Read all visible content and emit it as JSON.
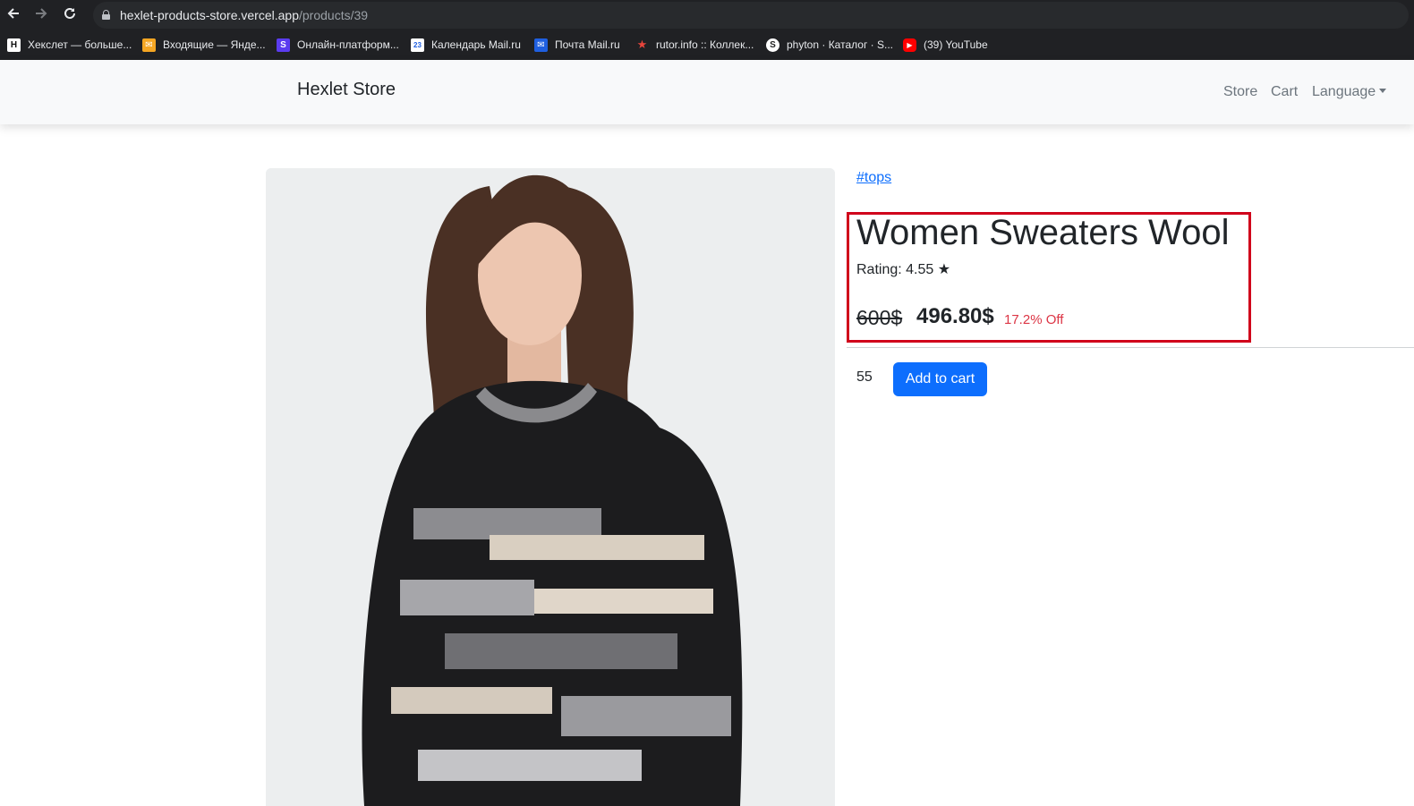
{
  "browser": {
    "url_host": "hexlet-products-store.vercel.app",
    "url_path": "/products/39",
    "bookmarks": [
      {
        "label": "Хекслет — больше...",
        "icon": "hexlet-icon",
        "color": "#111111",
        "glyph": "H"
      },
      {
        "label": "Входящие — Янде...",
        "icon": "yandex-mail-icon",
        "color": "#f5a623",
        "glyph": "✉"
      },
      {
        "label": "Онлайн-платформ...",
        "icon": "skillbox-icon",
        "color": "#5b3cf0",
        "glyph": "S"
      },
      {
        "label": "Календарь Mail.ru",
        "icon": "calendar-icon",
        "color": "#ffffff",
        "glyph": "23"
      },
      {
        "label": "Почта Mail.ru",
        "icon": "mail-ru-icon",
        "color": "#1f5fe0",
        "glyph": "✉"
      },
      {
        "label": "rutor.info :: Коллек...",
        "icon": "rutor-icon",
        "color": "#e8453c",
        "glyph": "★"
      },
      {
        "label": "phyton · Каталог · S...",
        "icon": "stepik-icon",
        "color": "#222222",
        "glyph": "S"
      },
      {
        "label": "(39) YouTube",
        "icon": "youtube-icon",
        "color": "#ff0000",
        "glyph": "▶"
      }
    ]
  },
  "navbar": {
    "brand": "Hexlet Store",
    "links": {
      "store": "Store",
      "cart": "Cart",
      "language": "Language"
    }
  },
  "product": {
    "tag": "#tops",
    "title": "Women Sweaters Wool",
    "rating_text": "Rating: 4.55 ★",
    "old_price": "600$",
    "new_price": "496.80$",
    "discount": "17.2% Off",
    "quantity": "55",
    "add_to_cart": "Add to cart"
  },
  "colors": {
    "primary": "#0d6efd",
    "danger": "#dc3545",
    "highlight": "#d0021b"
  }
}
